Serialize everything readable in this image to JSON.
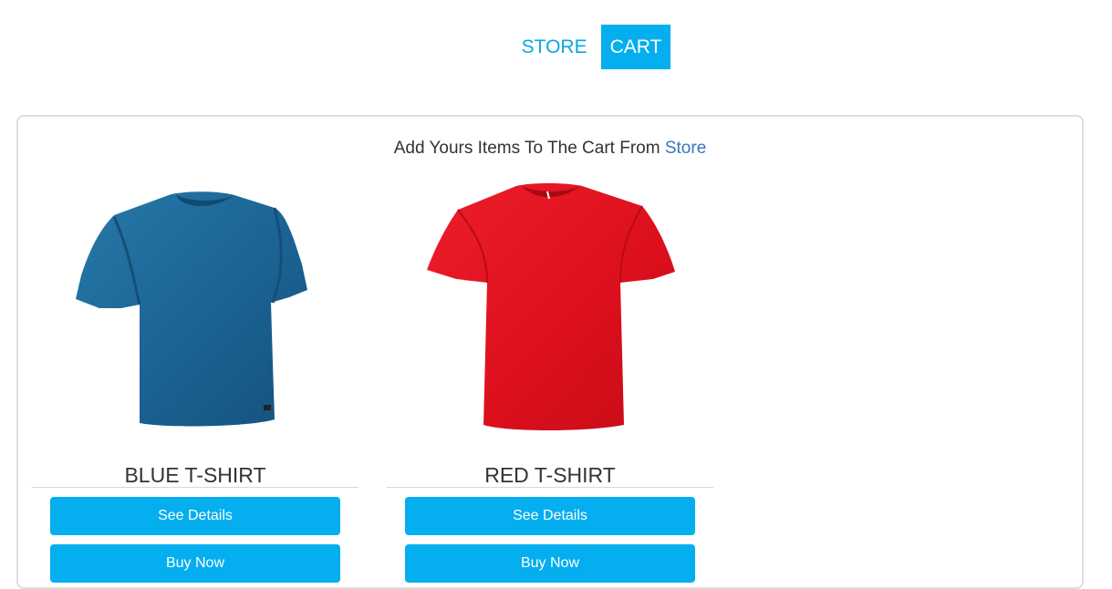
{
  "nav": {
    "tabs": [
      {
        "label": "STORE",
        "active": false
      },
      {
        "label": "CART",
        "active": true
      }
    ]
  },
  "cart": {
    "message_prefix": "Add Yours Items To The Cart From ",
    "message_link": "Store"
  },
  "products": [
    {
      "name": "BLUE T-SHIRT",
      "color": "#1e6a9a",
      "details_label": "See Details",
      "buy_label": "Buy Now"
    },
    {
      "name": "RED T-SHIRT",
      "color": "#e2121f",
      "details_label": "See Details",
      "buy_label": "Buy Now"
    }
  ],
  "colors": {
    "accent": "#05aeee",
    "link": "#3a78b8",
    "border": "#dedede"
  }
}
